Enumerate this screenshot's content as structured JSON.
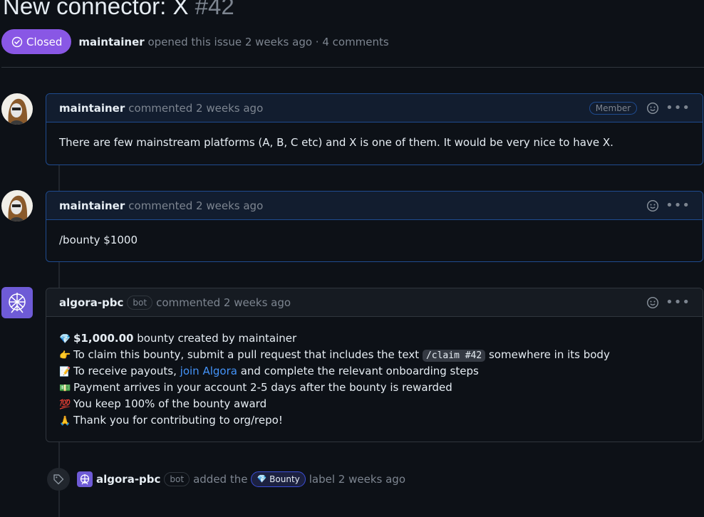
{
  "issue": {
    "title": "New connector: X",
    "number": "#42",
    "state": "Closed",
    "opener": "maintainer",
    "meta_text": "opened this issue 2 weeks ago · 4 comments"
  },
  "comments": [
    {
      "author": "maintainer",
      "action": "commented 2 weeks ago",
      "badge": "Member",
      "body": "There are few mainstream platforms (A, B, C etc) and X is one of them. It would be very nice to have X."
    },
    {
      "author": "maintainer",
      "action": "commented 2 weeks ago",
      "body": "/bounty $1000"
    },
    {
      "author": "algora-pbc",
      "bot_tag": "bot",
      "action": "commented 2 weeks ago",
      "lines": {
        "l1_amount": "$1,000.00",
        "l1_rest": " bounty created by maintainer",
        "l2_pre": "To claim this bounty, submit a pull request that includes the text ",
        "l2_code": "/claim #42",
        "l2_post": " somewhere in its body",
        "l3_pre": "To receive payouts, ",
        "l3_link": "join Algora",
        "l3_post": " and complete the relevant onboarding steps",
        "l4": "Payment arrives in your account 2-5 days after the bounty is rewarded",
        "l5": "You keep 100% of the bounty award",
        "l6": "Thank you for contributing to org/repo!"
      },
      "emojis": [
        "💎",
        "👉",
        "📝",
        "💵",
        "💯",
        "🙏"
      ]
    }
  ],
  "event": {
    "author": "algora-pbc",
    "bot_tag": "bot",
    "pre": "added the",
    "label": "Bounty",
    "label_emoji": "💎",
    "post": "label 2 weeks ago"
  },
  "icons": [
    "check-circle-icon",
    "smiley-icon",
    "kebab-icon",
    "tag-icon"
  ],
  "colors": {
    "closed": "#8957e5",
    "link": "#4493f8",
    "member_border": "#1f4b8f",
    "bot_avatar": "#6e5bd6"
  }
}
